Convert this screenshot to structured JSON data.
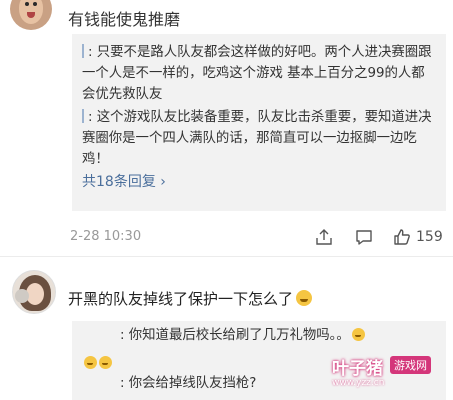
{
  "comment1": {
    "username": "有钱能使鬼推磨",
    "replies": [
      {
        "name": "",
        "text": "只要不是路人队友都会这样做的好吧。两个人进决赛圈跟一个人是不一样的，吃鸡这个游戏 基本上百分之99的人都会优先救队友"
      },
      {
        "name": "",
        "text": "这个游戏队友比装备重要，队友比击杀重要，要知道进决赛圈你是一个四人满队的话，那简直可以一边抠脚一边吃鸡！"
      }
    ],
    "reply_count": "共18条回复",
    "reply_count_arrow": "›",
    "timestamp": "2-28 10:30",
    "likes": "159"
  },
  "comment2": {
    "text": "开黑的队友掉线了保护一下怎么了",
    "replies": [
      {
        "name": "",
        "text": "你知道最后校长给刷了几万礼物吗。。"
      },
      {
        "name": "",
        "text": "你会给掉线队友挡枪?"
      }
    ]
  },
  "watermark": {
    "main": "叶子猪",
    "sub": "游戏网",
    "url": "www.yzz.cn"
  }
}
